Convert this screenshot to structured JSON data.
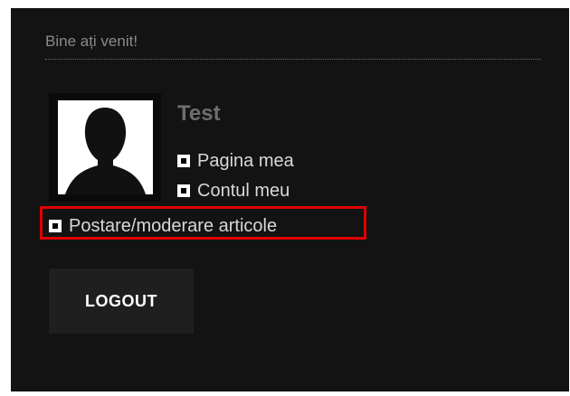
{
  "header": {
    "welcome_text": "Bine ați venit!"
  },
  "user": {
    "name": "Test",
    "avatar_icon": "user-silhouette-icon"
  },
  "menu": {
    "items": [
      {
        "label": "Pagina mea",
        "icon": "checkbox-square-icon"
      },
      {
        "label": "Contul meu",
        "icon": "checkbox-square-icon"
      },
      {
        "label": "Postare/moderare articole",
        "icon": "checkbox-square-icon",
        "highlighted": true
      }
    ]
  },
  "actions": {
    "logout_label": "LOGOUT"
  },
  "colors": {
    "panel_background": "#131313",
    "highlight_border": "#e00000",
    "button_background": "#1f1f1f"
  }
}
